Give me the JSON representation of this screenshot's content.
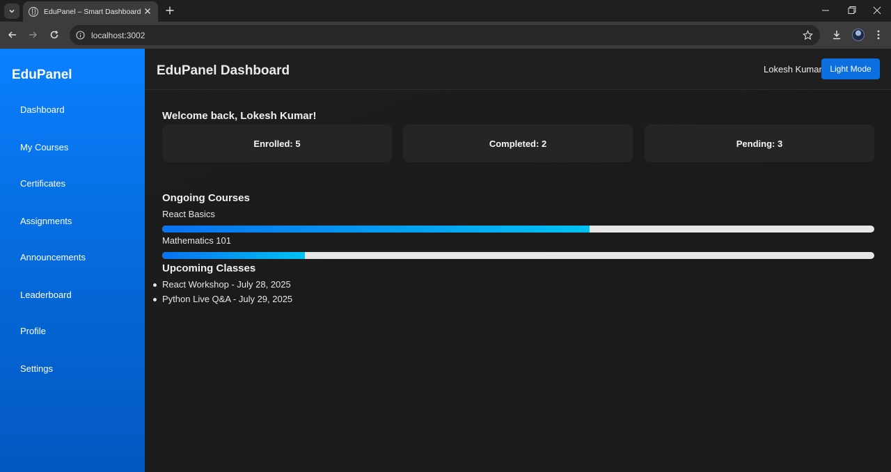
{
  "browser": {
    "tab_title": "EduPanel – Smart Dashboard",
    "url": "localhost:3002"
  },
  "sidebar": {
    "brand": "EduPanel",
    "items": [
      {
        "label": "Dashboard"
      },
      {
        "label": "My Courses"
      },
      {
        "label": "Certificates"
      },
      {
        "label": "Assignments"
      },
      {
        "label": "Announcements"
      },
      {
        "label": "Leaderboard"
      },
      {
        "label": "Profile"
      },
      {
        "label": "Settings"
      }
    ]
  },
  "header": {
    "title": "EduPanel Dashboard",
    "user_name": "Lokesh Kumar",
    "mode_button": "Light Mode"
  },
  "main": {
    "welcome": "Welcome back, Lokesh Kumar!",
    "stats": [
      {
        "label": "Enrolled: 5"
      },
      {
        "label": "Completed: 2"
      },
      {
        "label": "Pending: 3"
      }
    ],
    "ongoing_title": "Ongoing Courses",
    "courses": [
      {
        "name": "React Basics",
        "progress": 0.6
      },
      {
        "name": "Mathematics 101",
        "progress": 0.2
      }
    ],
    "upcoming_title": "Upcoming Classes",
    "classes": [
      {
        "text": "React Workshop - July 28, 2025"
      },
      {
        "text": "Python Live Q&A - July 29, 2025"
      }
    ]
  },
  "colors": {
    "accent": "#0b6fe0",
    "sidebar_top": "#0a80ff",
    "sidebar_bottom": "#0358c0",
    "progress_start": "#0a72f0",
    "progress_end": "#00c2f2"
  }
}
